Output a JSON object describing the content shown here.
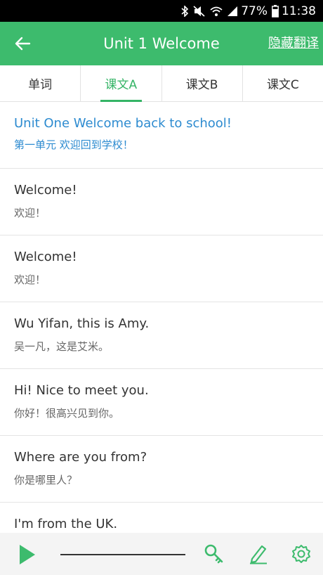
{
  "status_bar": {
    "icons": [
      "bluetooth-icon",
      "mute-icon",
      "wifi-icon",
      "signal-icon"
    ],
    "battery": "77%",
    "time": "11:38"
  },
  "app_bar": {
    "title": "Unit 1 Welcome",
    "hide_translation": "隐藏翻译",
    "color": "#3dbb6d"
  },
  "tabs": [
    {
      "label": "单词",
      "active": false
    },
    {
      "label": "课文A",
      "active": true
    },
    {
      "label": "课文B",
      "active": false
    },
    {
      "label": "课文C",
      "active": false
    }
  ],
  "lesson": {
    "heading": {
      "en": "Unit One Welcome back to school!",
      "zh": "第一单元 欢迎回到学校！"
    },
    "sentences": [
      {
        "en": "Welcome!",
        "zh": "欢迎！"
      },
      {
        "en": "Welcome!",
        "zh": "欢迎！"
      },
      {
        "en": "Wu Yifan, this is Amy.",
        "zh": "吴一凡，这是艾米。"
      },
      {
        "en": "Hi! Nice to meet you.",
        "zh": "你好！很高兴见到你。"
      },
      {
        "en": "Where are you from?",
        "zh": "你是哪里人？"
      },
      {
        "en": "I'm from the UK.",
        "zh": ""
      }
    ]
  },
  "player": {
    "icons": [
      "play-icon",
      "search-word-icon",
      "edit-icon",
      "settings-icon"
    ],
    "accent": "#3dbb6d"
  }
}
